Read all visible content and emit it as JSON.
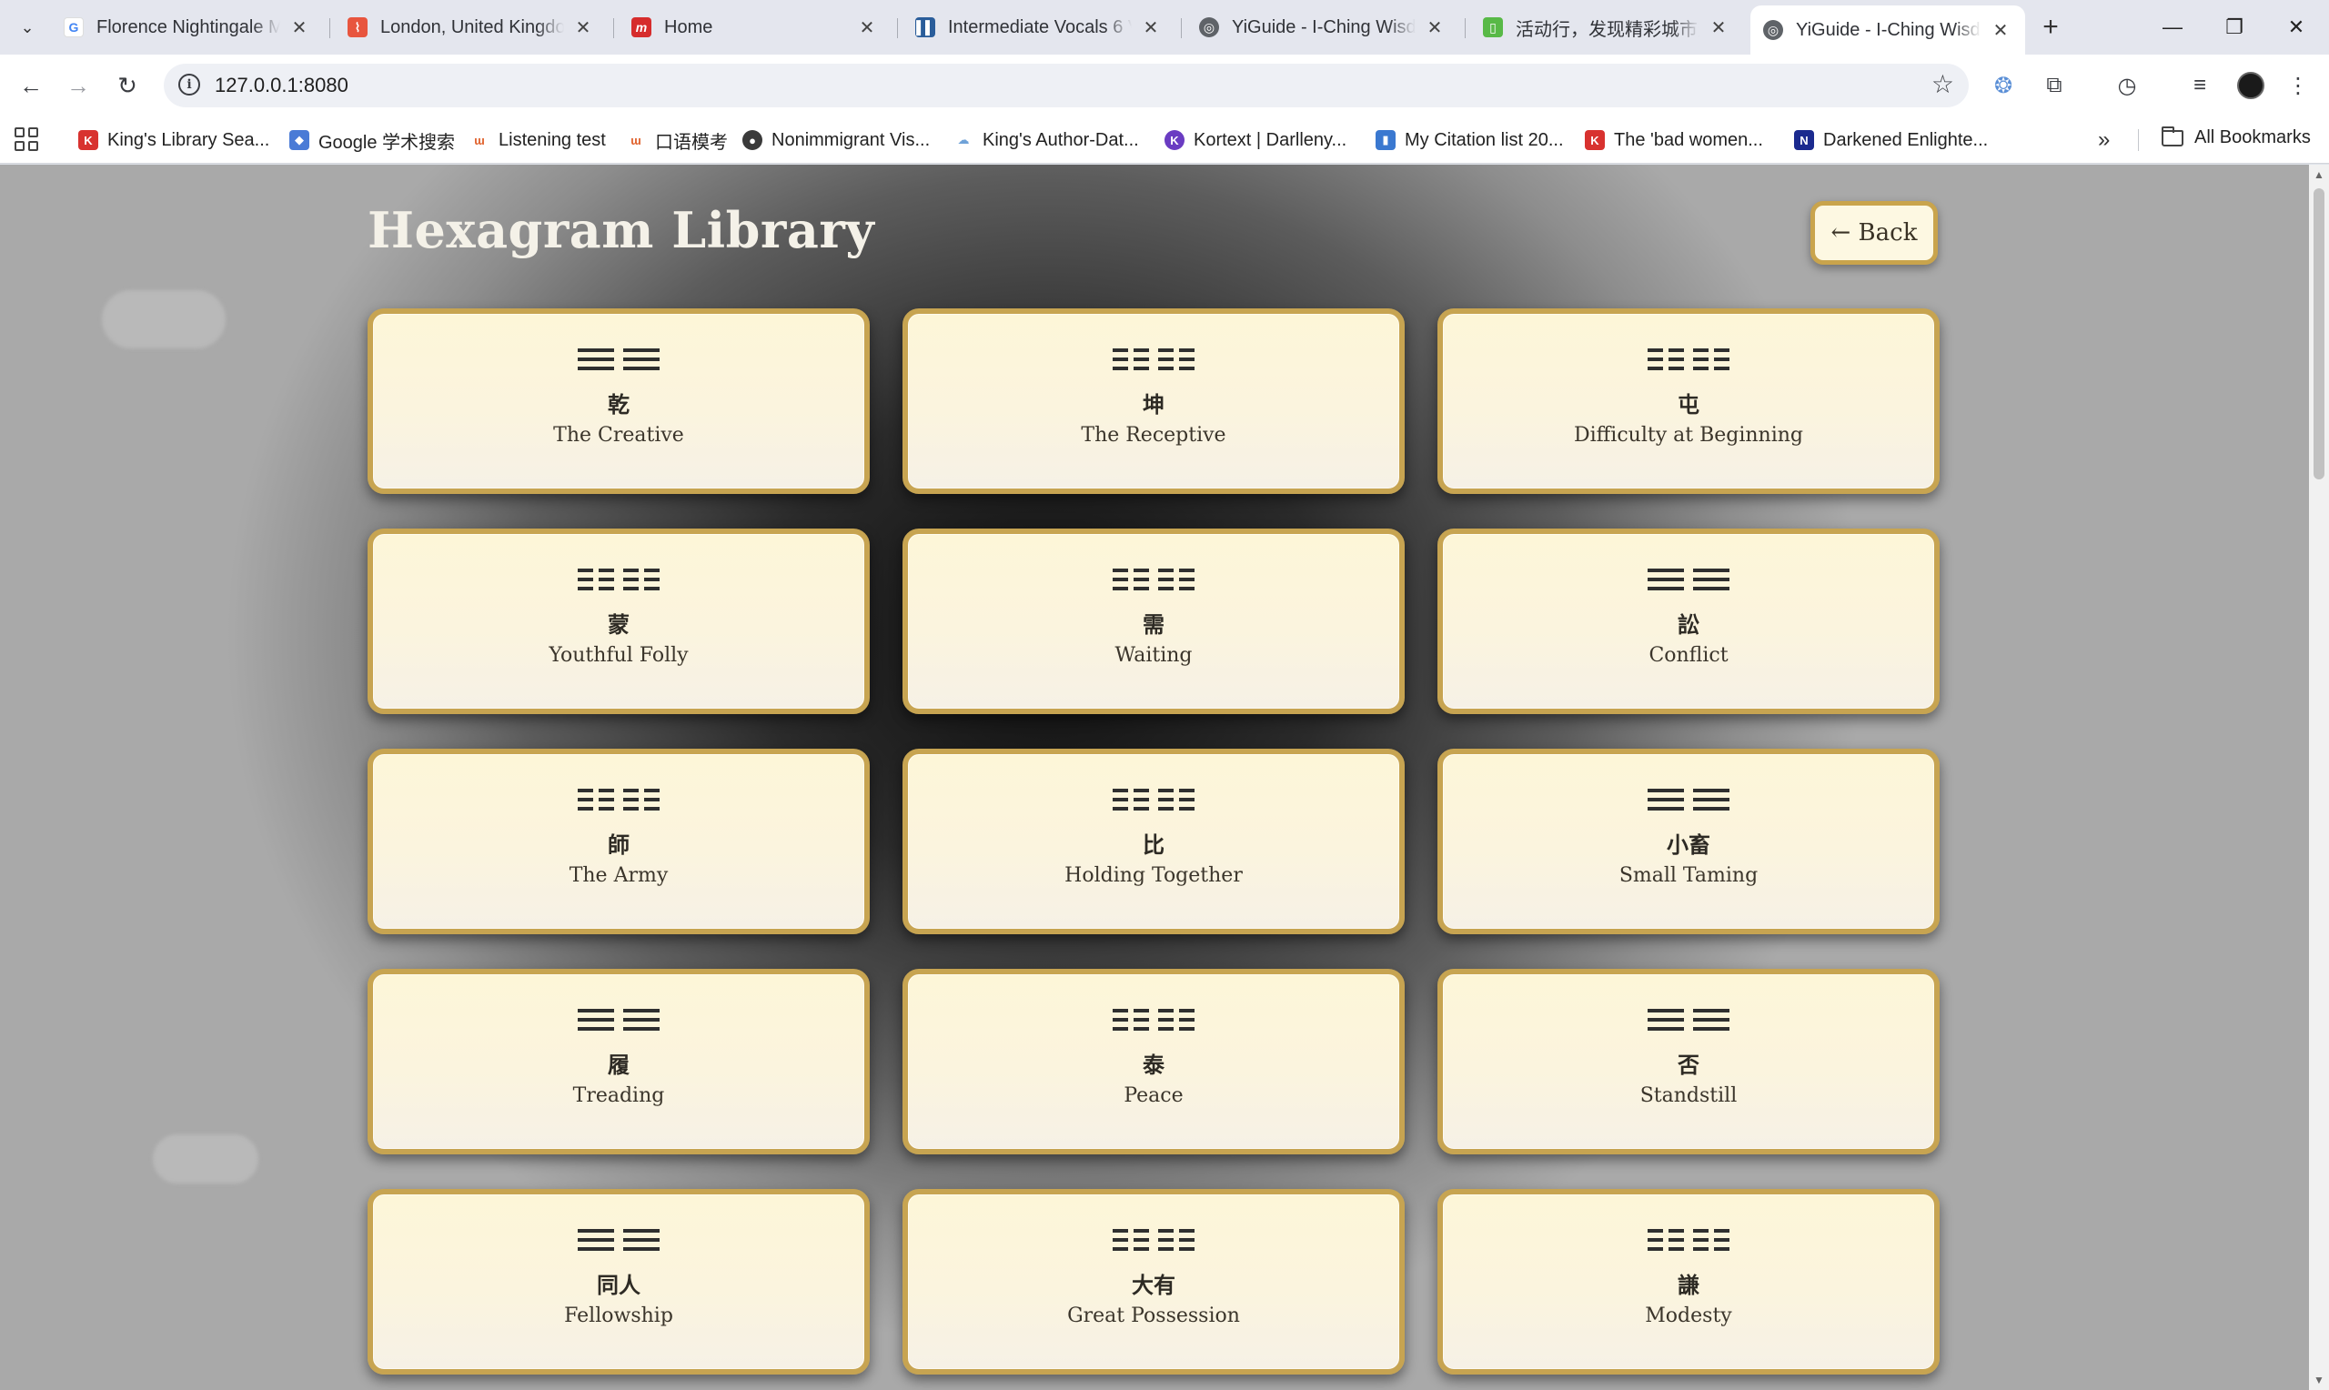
{
  "browser": {
    "tabs": [
      {
        "title": "Florence Nightingale M",
        "favicon": "google-icon",
        "color": "#4285f4"
      },
      {
        "title": "London, United Kingdo",
        "favicon": "bookmark-red-icon",
        "color": "#e8553e"
      },
      {
        "title": "Home",
        "favicon": "m-icon",
        "color": "#d62c2c"
      },
      {
        "title": "Intermediate Vocals 6 V",
        "favicon": "book-icon",
        "color": "#2a5d9a"
      },
      {
        "title": "YiGuide - I-Ching Wisd",
        "favicon": "globe-icon",
        "color": "#5f6368"
      },
      {
        "title": "活动行，发现精彩城市生",
        "favicon": "green-doc-icon",
        "color": "#58b947"
      },
      {
        "title": "YiGuide - I-Ching Wisd",
        "favicon": "globe-icon",
        "color": "#5f6368",
        "active": true
      }
    ],
    "url": "127.0.0.1:8080",
    "bookmarks": [
      {
        "label": "King's Library Sea...",
        "color": "#d8322f",
        "glyph": "K"
      },
      {
        "label": "Google 学术搜索",
        "color": "#4a7bd6",
        "glyph": "◆"
      },
      {
        "label": "Listening test",
        "color": "#e0612c",
        "glyph": "ɯ"
      },
      {
        "label": "口语模考",
        "color": "#e0612c",
        "glyph": "ɯ"
      },
      {
        "label": "Nonimmigrant Vis...",
        "color": "#3a3a3a",
        "glyph": "●"
      },
      {
        "label": "King's Author-Dat...",
        "color": "#6fa2d8",
        "glyph": "☁"
      },
      {
        "label": "Kortext | Darlleny...",
        "color": "#6a3cc2",
        "glyph": "K"
      },
      {
        "label": "My Citation list 20...",
        "color": "#3a78d0",
        "glyph": "▮"
      },
      {
        "label": "The 'bad women...",
        "color": "#d8322f",
        "glyph": "K"
      },
      {
        "label": "Darkened Enlighte...",
        "color": "#1b2a8f",
        "glyph": "N"
      }
    ],
    "all_bookmarks": "All Bookmarks"
  },
  "page": {
    "title": "Hexagram Library",
    "back_label": "← Back"
  },
  "hexagrams": [
    {
      "cn": "乾",
      "en": "The Creative",
      "top": "☰",
      "bottom": "☰"
    },
    {
      "cn": "坤",
      "en": "The Receptive",
      "top": "☷",
      "bottom": "☷"
    },
    {
      "cn": "屯",
      "en": "Difficulty at Beginning",
      "top": "☷",
      "bottom": "☷"
    },
    {
      "cn": "蒙",
      "en": "Youthful Folly",
      "top": "☷",
      "bottom": "☷"
    },
    {
      "cn": "需",
      "en": "Waiting",
      "top": "☷",
      "bottom": "☰"
    },
    {
      "cn": "訟",
      "en": "Conflict",
      "top": "☰",
      "bottom": "☰"
    },
    {
      "cn": "師",
      "en": "The Army",
      "top": "☷",
      "bottom": "☷"
    },
    {
      "cn": "比",
      "en": "Holding Together",
      "top": "☷",
      "bottom": "☷"
    },
    {
      "cn": "小畜",
      "en": "Small Taming",
      "top": "☰",
      "bottom": "☰"
    },
    {
      "cn": "履",
      "en": "Treading",
      "top": "☰",
      "bottom": "☰"
    },
    {
      "cn": "泰",
      "en": "Peace",
      "top": "☷",
      "bottom": "☰"
    },
    {
      "cn": "否",
      "en": "Standstill",
      "top": "☰",
      "bottom": "☷"
    },
    {
      "cn": "同人",
      "en": "Fellowship",
      "top": "☰",
      "bottom": "☰"
    },
    {
      "cn": "大有",
      "en": "Great Possession",
      "top": "☷",
      "bottom": "☰"
    },
    {
      "cn": "謙",
      "en": "Modesty",
      "top": "☷",
      "bottom": "☷"
    }
  ]
}
